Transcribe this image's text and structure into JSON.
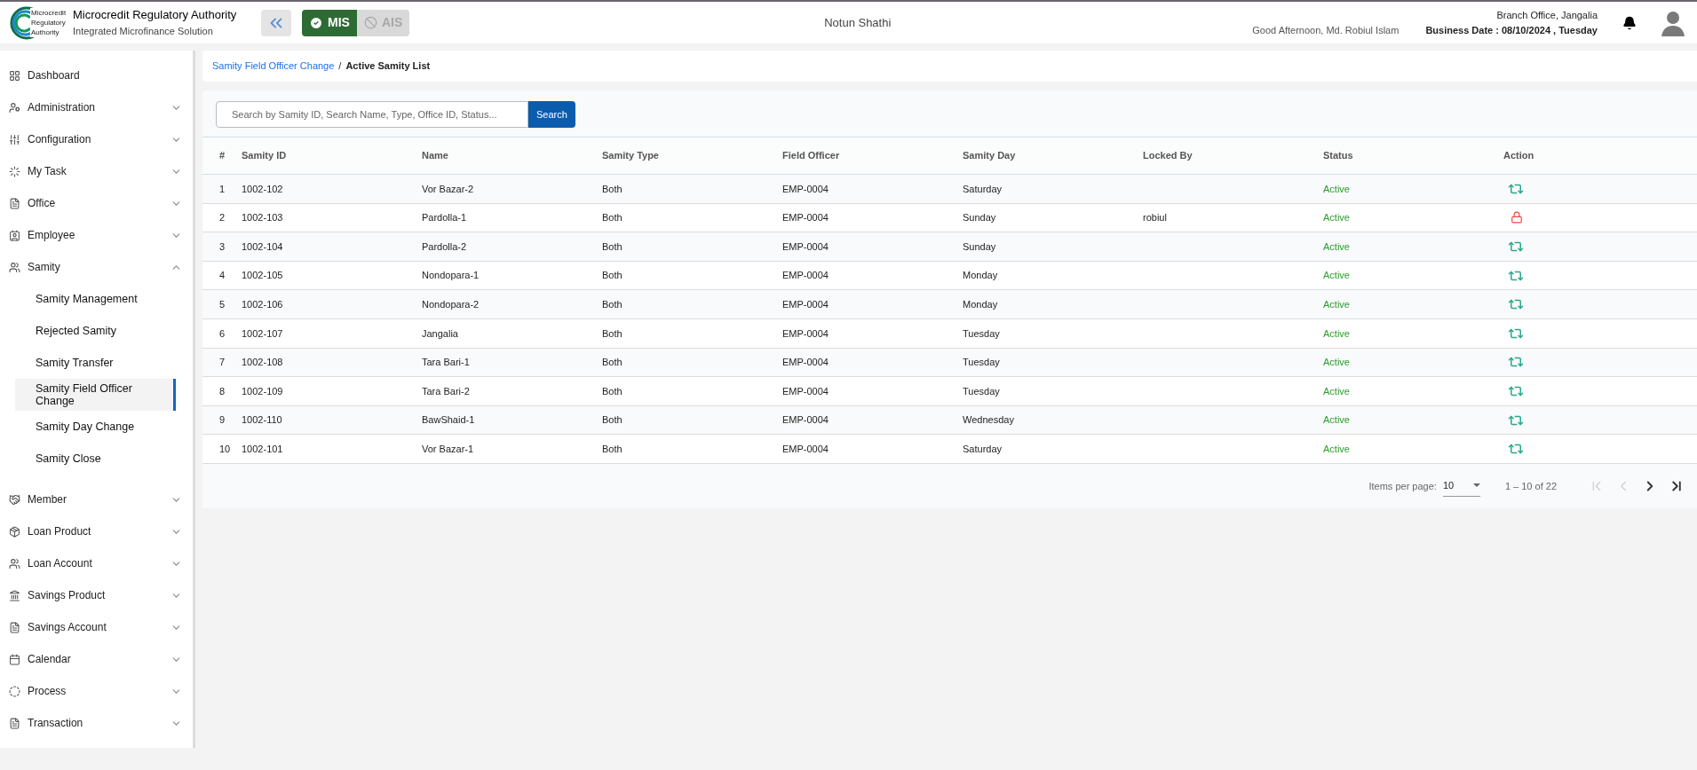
{
  "header": {
    "logo_text": [
      "Microcredit",
      "Regulatory",
      "Authority"
    ],
    "org_name": "Microcredit Regulatory Authority",
    "org_subtitle": "Integrated Microfinance Solution",
    "modes": [
      {
        "label": "MIS",
        "selected": true
      },
      {
        "label": "AIS",
        "selected": false
      }
    ],
    "app_name": "Notun Shathi",
    "greeting": "Good Afternoon, Md. Robiul Islam",
    "office": "Branch Office, Jangalia",
    "business_date": "Business Date : 08/10/2024 , Tuesday"
  },
  "sidebar": {
    "items": [
      {
        "label": "Dashboard",
        "kind": "link"
      },
      {
        "label": "Administration",
        "kind": "group",
        "expanded": false
      },
      {
        "label": "Configuration",
        "kind": "group",
        "expanded": false
      },
      {
        "label": "My Task",
        "kind": "group",
        "expanded": false
      },
      {
        "label": "Office",
        "kind": "group",
        "expanded": false
      },
      {
        "label": "Employee",
        "kind": "group",
        "expanded": false
      },
      {
        "label": "Samity",
        "kind": "group",
        "expanded": true,
        "children": [
          {
            "label": "Samity Management",
            "selected": false
          },
          {
            "label": "Rejected Samity",
            "selected": false
          },
          {
            "label": "Samity Transfer",
            "selected": false
          },
          {
            "label": "Samity Field Officer Change",
            "selected": true
          },
          {
            "label": "Samity Day Change",
            "selected": false
          },
          {
            "label": "Samity Close",
            "selected": false
          }
        ]
      },
      {
        "label": "Member",
        "kind": "group",
        "expanded": false
      },
      {
        "label": "Loan Product",
        "kind": "group",
        "expanded": false
      },
      {
        "label": "Loan Account",
        "kind": "group",
        "expanded": false
      },
      {
        "label": "Savings Product",
        "kind": "group",
        "expanded": false
      },
      {
        "label": "Savings Account",
        "kind": "group",
        "expanded": false
      },
      {
        "label": "Calendar",
        "kind": "group",
        "expanded": false
      },
      {
        "label": "Process",
        "kind": "group",
        "expanded": false
      },
      {
        "label": "Transaction",
        "kind": "group",
        "expanded": false
      }
    ]
  },
  "breadcrumb": {
    "link": "Samity Field Officer Change",
    "separator": "/",
    "current": "Active Samity List"
  },
  "search": {
    "placeholder": "Search by Samity ID, Search Name, Type, Office ID, Status...",
    "button": "Search"
  },
  "table": {
    "columns": [
      "#",
      "Samity ID",
      "Name",
      "Samity Type",
      "Field Officer",
      "Samity Day",
      "Locked By",
      "Status",
      "Action"
    ],
    "rows": [
      {
        "no": "1",
        "samity_id": "1002-102",
        "name": "Vor Bazar-2",
        "type": "Both",
        "field_officer": "EMP-0004",
        "day": "Saturday",
        "status": "Active",
        "kind": "transfer"
      },
      {
        "no": "2",
        "samity_id": "1002-103",
        "name": "Pardolla-1",
        "type": "Both",
        "field_officer": "EMP-0004",
        "day": "Sunday",
        "locked_by": "robiul",
        "status": "Active",
        "kind": "locked"
      },
      {
        "no": "3",
        "samity_id": "1002-104",
        "name": "Pardolla-2",
        "type": "Both",
        "field_officer": "EMP-0004",
        "day": "Sunday",
        "status": "Active",
        "kind": "transfer"
      },
      {
        "no": "4",
        "samity_id": "1002-105",
        "name": "Nondopara-1",
        "type": "Both",
        "field_officer": "EMP-0004",
        "day": "Monday",
        "status": "Active",
        "kind": "transfer"
      },
      {
        "no": "5",
        "samity_id": "1002-106",
        "name": "Nondopara-2",
        "type": "Both",
        "field_officer": "EMP-0004",
        "day": "Monday",
        "status": "Active",
        "kind": "transfer"
      },
      {
        "no": "6",
        "samity_id": "1002-107",
        "name": "Jangalia",
        "type": "Both",
        "field_officer": "EMP-0004",
        "day": "Tuesday",
        "status": "Active",
        "kind": "transfer"
      },
      {
        "no": "7",
        "samity_id": "1002-108",
        "name": "Tara Bari-1",
        "type": "Both",
        "field_officer": "EMP-0004",
        "day": "Tuesday",
        "status": "Active",
        "kind": "transfer"
      },
      {
        "no": "8",
        "samity_id": "1002-109",
        "name": "Tara Bari-2",
        "type": "Both",
        "field_officer": "EMP-0004",
        "day": "Tuesday",
        "status": "Active",
        "kind": "transfer"
      },
      {
        "no": "9",
        "samity_id": "1002-110",
        "name": "BawShaid-1",
        "type": "Both",
        "field_officer": "EMP-0004",
        "day": "Wednesday",
        "status": "Active",
        "kind": "transfer"
      },
      {
        "no": "10",
        "samity_id": "1002-101",
        "name": "Vor Bazar-1",
        "type": "Both",
        "field_officer": "EMP-0004",
        "day": "Saturday",
        "status": "Active",
        "kind": "transfer"
      }
    ]
  },
  "pagination": {
    "items_label": "Items per page:",
    "page_size": "10",
    "range": "1 – 10 of 22",
    "buttons": [
      {
        "kind": "first",
        "disabled": true
      },
      {
        "kind": "prev",
        "disabled": true
      },
      {
        "kind": "next",
        "disabled": false
      },
      {
        "kind": "last",
        "disabled": false
      }
    ]
  }
}
